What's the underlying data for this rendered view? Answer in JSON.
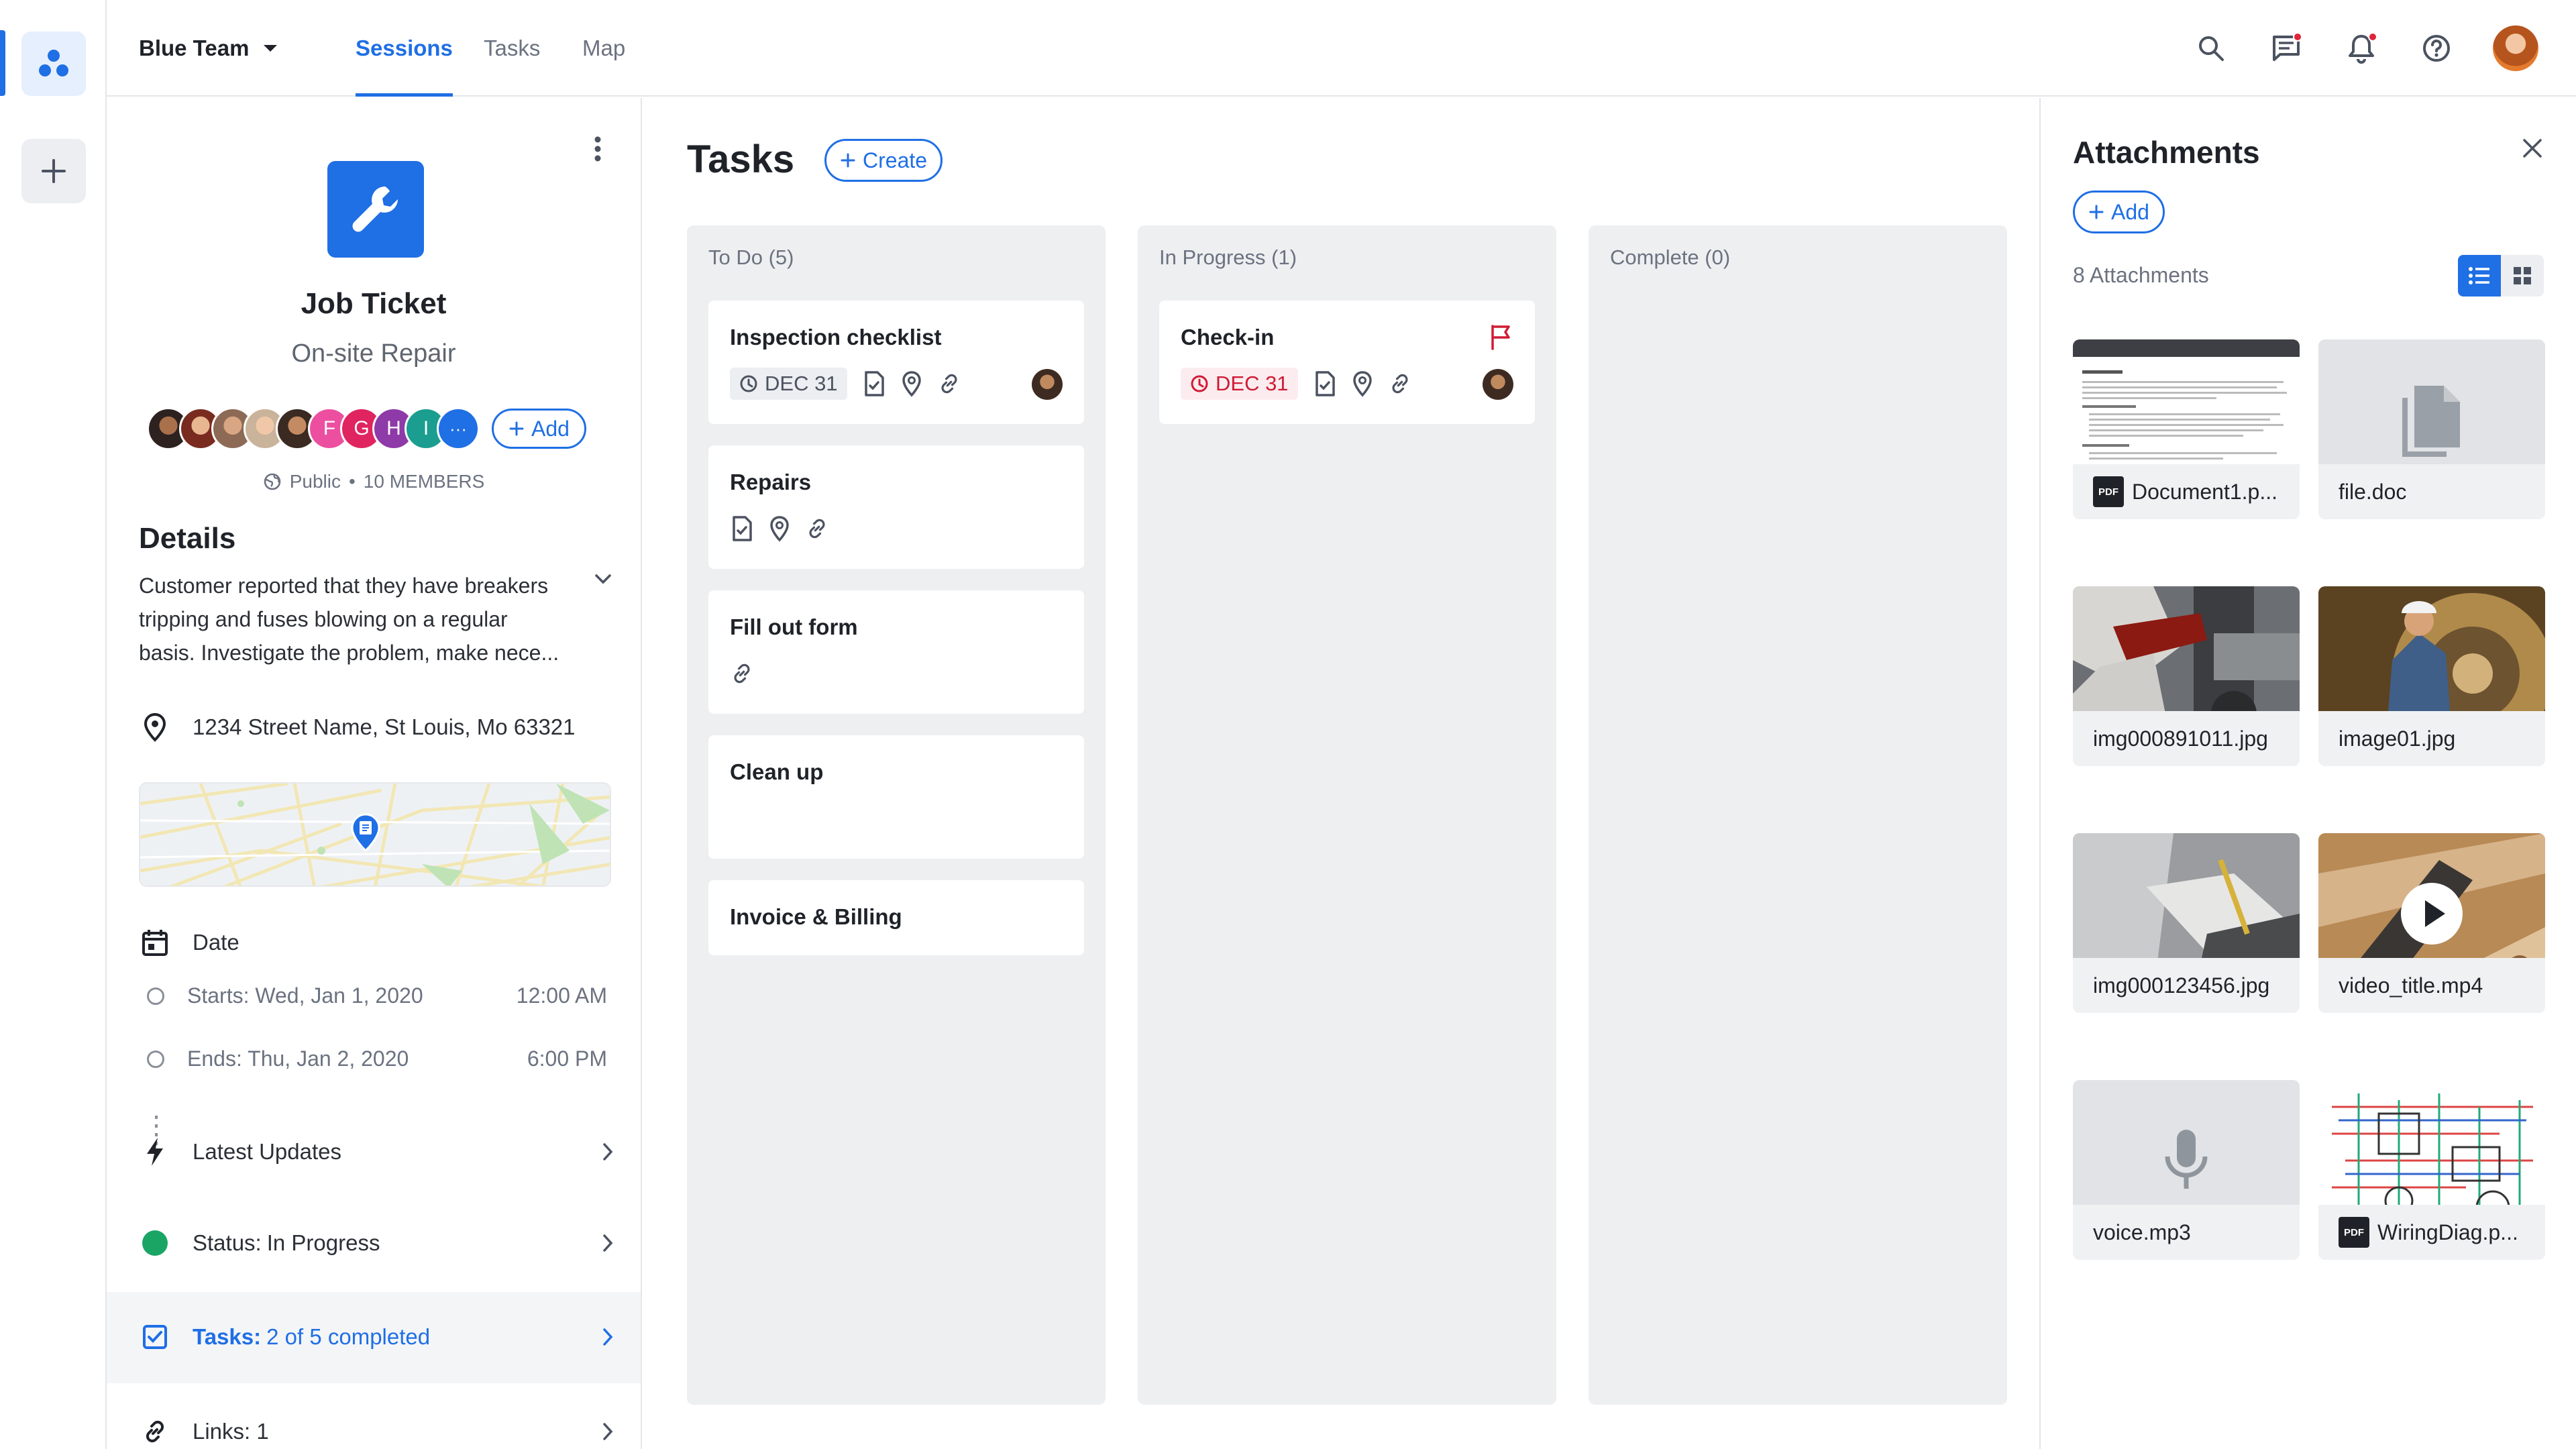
{
  "topbar": {
    "team_name": "Blue Team",
    "tabs": [
      {
        "label": "Sessions",
        "active": true
      },
      {
        "label": "Tasks",
        "active": false
      },
      {
        "label": "Map",
        "active": false
      }
    ],
    "icons": [
      "search-icon",
      "chat-icon",
      "bell-icon",
      "help-icon"
    ]
  },
  "ticket": {
    "title": "Job Ticket",
    "subtitle": "On-site Repair",
    "member_initials": [
      "F",
      "G",
      "H",
      "I"
    ],
    "more_label": "···",
    "add_label": "Add",
    "visibility": "Public",
    "members_text": "10  MEMBERS",
    "details_title": "Details",
    "description": "Customer reported that they have breakers tripping and fuses blowing on a regular basis. Investigate the problem, make nece...",
    "address": "1234 Street Name, St Louis, Mo 63321",
    "date_label": "Date",
    "starts": "Starts: Wed, Jan 1, 2020",
    "start_time": "12:00 AM",
    "ends": "Ends: Thu, Jan 2, 2020",
    "end_time": "6:00 PM",
    "latest_updates": "Latest Updates",
    "status_prefix": "Status:",
    "status_value": "In Progress",
    "tasks_prefix": "Tasks:",
    "tasks_value": "2 of 5 completed",
    "links": "Links: 1"
  },
  "board": {
    "title": "Tasks",
    "create_label": "Create",
    "columns": [
      {
        "header": "To Do (5)",
        "cards": [
          {
            "title": "Inspection checklist",
            "date": "DEC 31"
          },
          {
            "title": "Repairs"
          },
          {
            "title": "Fill out form"
          },
          {
            "title": "Clean up"
          },
          {
            "title": "Invoice & Billing"
          }
        ]
      },
      {
        "header": "In Progress (1)",
        "cards": [
          {
            "title": "Check-in",
            "date": "DEC 31"
          }
        ]
      },
      {
        "header": "Complete (0)",
        "cards": []
      }
    ]
  },
  "attachments": {
    "title": "Attachments",
    "add_label": "Add",
    "count": "8 Attachments",
    "files": [
      {
        "name": "Document1.p...",
        "kind": "pdf"
      },
      {
        "name": "file.doc",
        "kind": "doc"
      },
      {
        "name": "img000891011.jpg",
        "kind": "image"
      },
      {
        "name": "image01.jpg",
        "kind": "image"
      },
      {
        "name": "img000123456.jpg",
        "kind": "image"
      },
      {
        "name": "video_title.mp4",
        "kind": "video"
      },
      {
        "name": "voice.mp3",
        "kind": "audio"
      },
      {
        "name": "WiringDiag.p...",
        "kind": "pdf"
      }
    ]
  },
  "colors": {
    "accent": "#1f6fe5",
    "status_in_progress": "#1aa565",
    "overdue": "#d01b35",
    "notification": "#e0243a"
  }
}
